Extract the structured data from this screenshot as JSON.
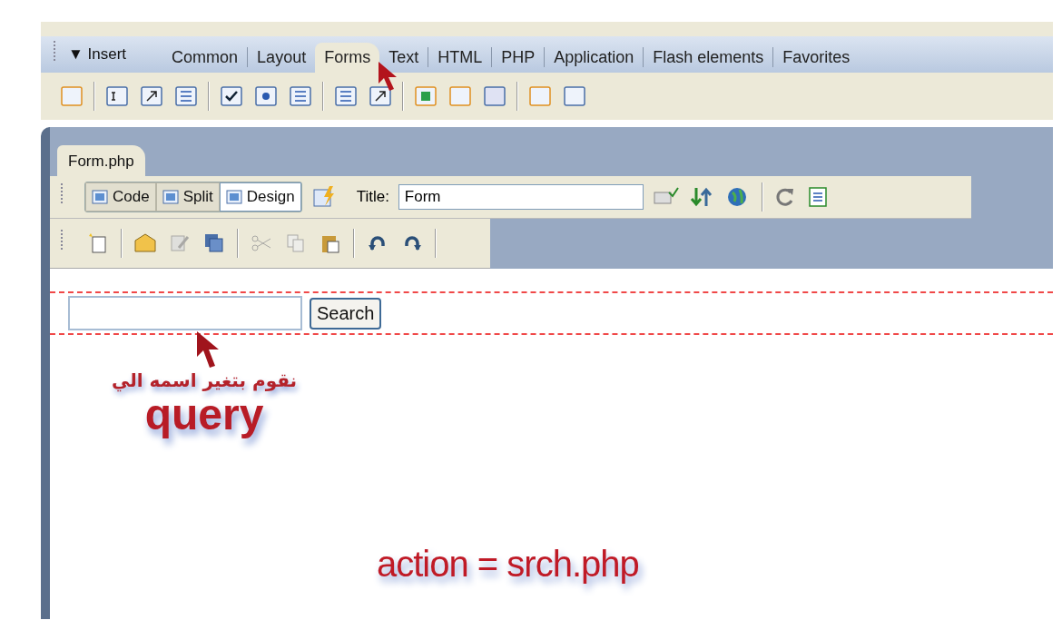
{
  "insert_panel": {
    "label": "▼ Insert",
    "tabs": [
      {
        "label": "Common",
        "selected": false
      },
      {
        "label": "Layout",
        "selected": false
      },
      {
        "label": "Forms",
        "selected": true
      },
      {
        "label": "Text",
        "selected": false
      },
      {
        "label": "HTML",
        "selected": false
      },
      {
        "label": "PHP",
        "selected": false
      },
      {
        "label": "Application",
        "selected": false
      },
      {
        "label": "Flash elements",
        "selected": false
      },
      {
        "label": "Favorites",
        "selected": false
      }
    ]
  },
  "document": {
    "tab": "Form.php",
    "views": [
      {
        "label": "Code",
        "selected": false
      },
      {
        "label": "Split",
        "selected": false
      },
      {
        "label": "Design",
        "selected": true
      }
    ],
    "title_label": "Title:",
    "title_value": "Form"
  },
  "design": {
    "search_button": "Search",
    "annotations": {
      "arabic_note": "نقوم بتغير اسمه الي",
      "field_name": "query",
      "action_note": "action = srch.php"
    }
  }
}
